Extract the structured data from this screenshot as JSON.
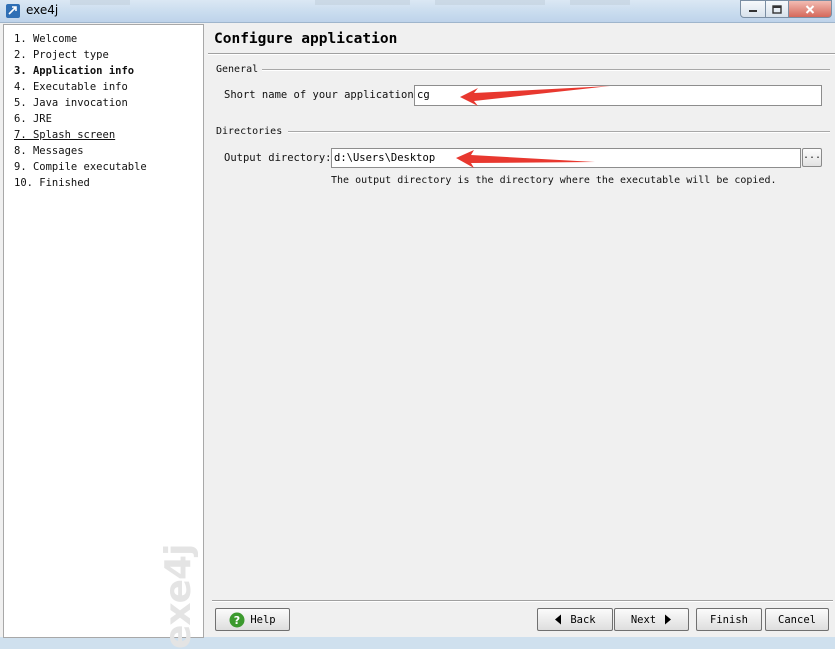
{
  "window": {
    "title": "exe4j"
  },
  "sidebar": {
    "steps": [
      {
        "label": "1.  Welcome"
      },
      {
        "label": "2.  Project type"
      },
      {
        "label": "3.  Application info"
      },
      {
        "label": "4.  Executable info"
      },
      {
        "label": "5.  Java invocation"
      },
      {
        "label": "6.  JRE"
      },
      {
        "label": "7.  Splash screen"
      },
      {
        "label": "8.  Messages"
      },
      {
        "label": "9.  Compile executable"
      },
      {
        "label": "10.  Finished"
      }
    ],
    "watermark": "exe4j"
  },
  "main": {
    "title": "Configure application",
    "general": {
      "label": "General",
      "short_name_label": "Short name of your application:",
      "short_name_value": "cg"
    },
    "directories": {
      "label": "Directories",
      "output_label": "Output directory:",
      "output_value": "d:\\Users\\Desktop",
      "browse_label": "...",
      "hint": "The output directory is the directory where the executable will be copied."
    }
  },
  "footer": {
    "help": "Help",
    "back": "Back",
    "next": "Next",
    "finish": "Finish",
    "cancel": "Cancel"
  },
  "colors": {
    "annotation_arrow": "#e8382f",
    "help_icon": "#3c9a2e"
  }
}
